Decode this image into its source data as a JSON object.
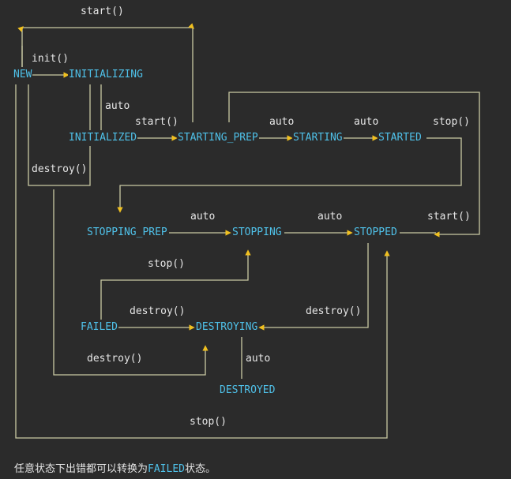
{
  "colors": {
    "background": "#2b2b2b",
    "state": "#4fc1e9",
    "label": "#e6e6e6",
    "wire": "#c9c9a3",
    "arrow": "#f0c020"
  },
  "states": {
    "new": "NEW",
    "initializing": "INITIALIZING",
    "initialized": "INITIALIZED",
    "starting_prep": "STARTING_PREP",
    "starting": "STARTING",
    "started": "STARTED",
    "stopping_prep": "STOPPING_PREP",
    "stopping": "STOPPING",
    "stopped": "STOPPED",
    "failed": "FAILED",
    "destroying": "DESTROYING",
    "destroyed": "DESTROYED"
  },
  "labels": {
    "start_top": "start()",
    "init": "init()",
    "auto_initializing": "auto",
    "start_initialized": "start()",
    "auto_starting_prep": "auto",
    "auto_starting": "auto",
    "stop_started": "stop()",
    "destroy_left": "destroy()",
    "auto_stopping_prep": "auto",
    "auto_stopping": "auto",
    "start_stopped": "start()",
    "stop_failed": "stop()",
    "destroy_failed": "destroy()",
    "destroy_stopped": "destroy()",
    "destroy_bottom": "destroy()",
    "auto_destroying": "auto",
    "stop_bottom": "stop()"
  },
  "note": {
    "prefix": "任意状态下出错都可以转换为",
    "state": "FAILED",
    "suffix": "状态。"
  }
}
